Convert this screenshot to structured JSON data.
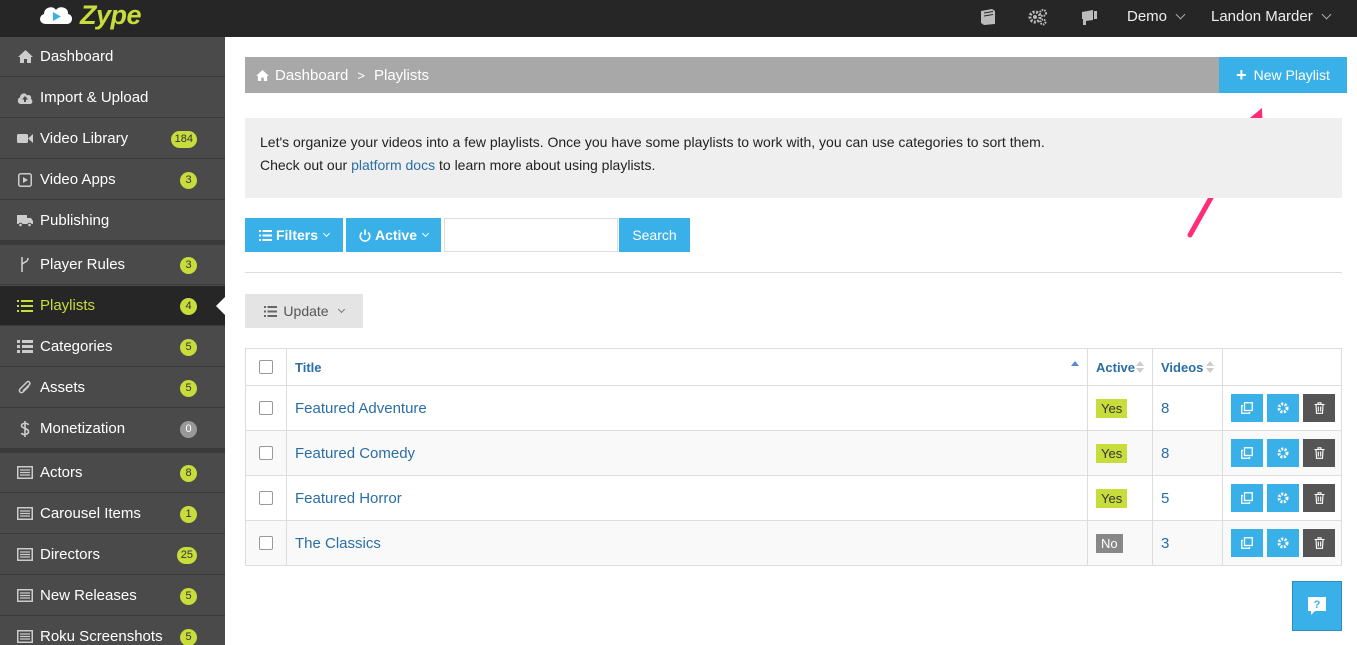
{
  "brand": {
    "name": "Zype"
  },
  "topbar": {
    "icons": [
      "book-icon",
      "gears-icon",
      "announce-icon"
    ],
    "org_menu": "Demo",
    "user_menu": "Landon Marder"
  },
  "sidebar": {
    "items": [
      {
        "label": "Dashboard",
        "icon": "home-icon",
        "badge": ""
      },
      {
        "label": "Import & Upload",
        "icon": "cloud-upload-icon",
        "badge": ""
      },
      {
        "label": "Video Library",
        "icon": "video-camera-icon",
        "badge": "184"
      },
      {
        "label": "Video Apps",
        "icon": "play-square-icon",
        "badge": "3"
      },
      {
        "label": "Publishing",
        "icon": "truck-icon",
        "badge": ""
      },
      {
        "label": "Player Rules",
        "icon": "fork-icon",
        "badge": "3"
      },
      {
        "label": "Playlists",
        "icon": "list-ol-icon",
        "badge": "4"
      },
      {
        "label": "Categories",
        "icon": "list-icon",
        "badge": "5"
      },
      {
        "label": "Assets",
        "icon": "paperclip-icon",
        "badge": "5"
      },
      {
        "label": "Monetization",
        "icon": "dollar-icon",
        "badge": "0"
      },
      {
        "label": "Actors",
        "icon": "list-alt-icon",
        "badge": "8"
      },
      {
        "label": "Carousel Items",
        "icon": "list-alt-icon",
        "badge": "1"
      },
      {
        "label": "Directors",
        "icon": "list-alt-icon",
        "badge": "25"
      },
      {
        "label": "New Releases",
        "icon": "list-alt-icon",
        "badge": "5"
      },
      {
        "label": "Roku Screenshots",
        "icon": "list-alt-icon",
        "badge": "5"
      }
    ],
    "active_index": 6
  },
  "breadcrumb": {
    "home": "Dashboard",
    "separator": ">",
    "current": "Playlists"
  },
  "new_button": {
    "label": "New Playlist"
  },
  "info": {
    "line1": "Let's organize your videos into a few playlists. Once you have some playlists to work with, you can use categories to sort them.",
    "line2_pre": "Check out our ",
    "line2_link": "platform docs",
    "line2_post": " to learn more about using playlists."
  },
  "filters": {
    "filters_label": "Filters",
    "active_label": "Active",
    "search_value": "",
    "search_button": "Search"
  },
  "update_button": {
    "label": "Update"
  },
  "table": {
    "columns": {
      "title": "Title",
      "active": "Active",
      "videos": "Videos"
    },
    "rows": [
      {
        "title": "Featured Adventure",
        "active": "Yes",
        "videos": "8"
      },
      {
        "title": "Featured Comedy",
        "active": "Yes",
        "videos": "8"
      },
      {
        "title": "Featured Horror",
        "active": "Yes",
        "videos": "5"
      },
      {
        "title": "The Classics",
        "active": "No",
        "videos": "3"
      }
    ]
  },
  "help": {
    "label": "?"
  },
  "colors": {
    "accent": "#3ab0e8",
    "brand_green": "#c8dc3c",
    "sidebar": "#4a4a4a",
    "topbar": "#262626",
    "arrow": "#ff2d78"
  }
}
